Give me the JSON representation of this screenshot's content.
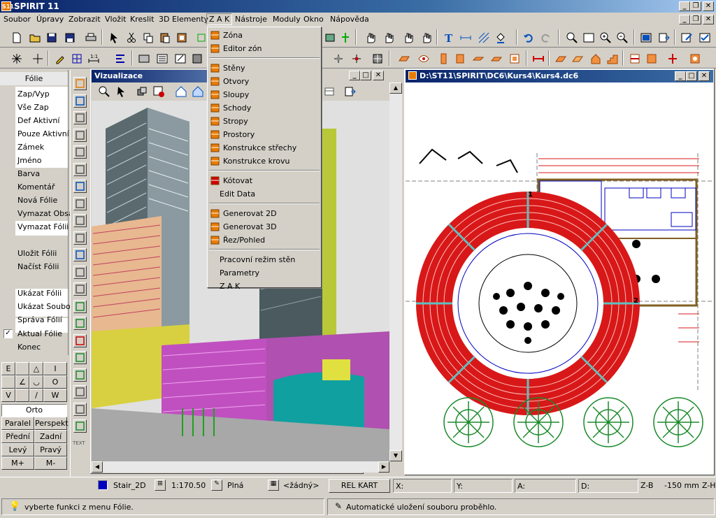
{
  "app": {
    "title": "SPIRIT 11",
    "icon_text": "S11"
  },
  "menubar": [
    "Soubor",
    "Úpravy",
    "Zobrazit",
    "Vložit",
    "Kreslit",
    "3D Elementy",
    "Z A K",
    "Nástroje",
    "Moduly",
    "Okno",
    "Nápověda"
  ],
  "zak_menu": {
    "group1": [
      "Zóna",
      "Editor zón"
    ],
    "group2": [
      "Stěny",
      "Otvory",
      "Sloupy",
      "Schody",
      "Stropy",
      "Prostory",
      "Konstrukce střechy",
      "Konstrukce krovu"
    ],
    "group3": [
      "Kótovat",
      "Edit Data"
    ],
    "group4": [
      "Generovat 2D",
      "Generovat 3D",
      "Řez/Pohled"
    ],
    "group5": [
      "Pracovní režim stěn",
      "Parametry",
      "Z A K"
    ]
  },
  "layer_panel": {
    "header": "Fólie",
    "items": [
      "Zap/Vyp",
      "Vše Zap",
      "Def Aktivní",
      "Pouze Aktivní",
      "Zámek",
      "Jméno",
      "Barva",
      "Komentář",
      "Nová Fólie",
      "Vymazat Obsa",
      "Vymazat Fólii",
      "Uložit Fólii",
      "Načíst Fólii",
      "Ukázat Fólii",
      "Ukázat Soubor",
      "Správa Fólií",
      "Aktual Fólie",
      "Konec"
    ],
    "checked_item": "Aktual Fólie"
  },
  "snap_pad": {
    "keys": [
      "E",
      "I",
      "O",
      "V",
      "W"
    ],
    "orto": "Orto",
    "view_buttons": [
      [
        "Paralel",
        "Perspekt"
      ],
      [
        "Přední",
        "Zadní"
      ],
      [
        "Levý",
        "Pravý"
      ],
      [
        "M+",
        "M-"
      ]
    ]
  },
  "visualization_window": {
    "title": "Vizualizace"
  },
  "drawing_window": {
    "title": "D:\\ST11\\SPIRIT\\DC6\\Kurs4\\Kurs4.dc6",
    "labels": [
      "1",
      "2"
    ]
  },
  "side_toolbar": {
    "text_label": "TEXT"
  },
  "property_bar": {
    "layer": "Stair_2D",
    "scale": "1:170.50",
    "fill": "Plná",
    "pattern": "<žádný>",
    "rel": "REL KART",
    "x": "X:",
    "y": "Y:",
    "a": "A:",
    "d": "D:",
    "zb": "Z-B",
    "zb_value": "-150 mm",
    "zh": "Z-H"
  },
  "status_bar": {
    "left": "vyberte funkci z menu Fólie.",
    "right": "Automatické uložení souboru proběhlo."
  },
  "colors": {
    "title_start": "#0a246a",
    "title_end": "#a6caf0",
    "accent": "#e87b00",
    "cad_red": "#d81818",
    "cad_green": "#1a8a2a",
    "cad_blue": "#0000c0"
  }
}
